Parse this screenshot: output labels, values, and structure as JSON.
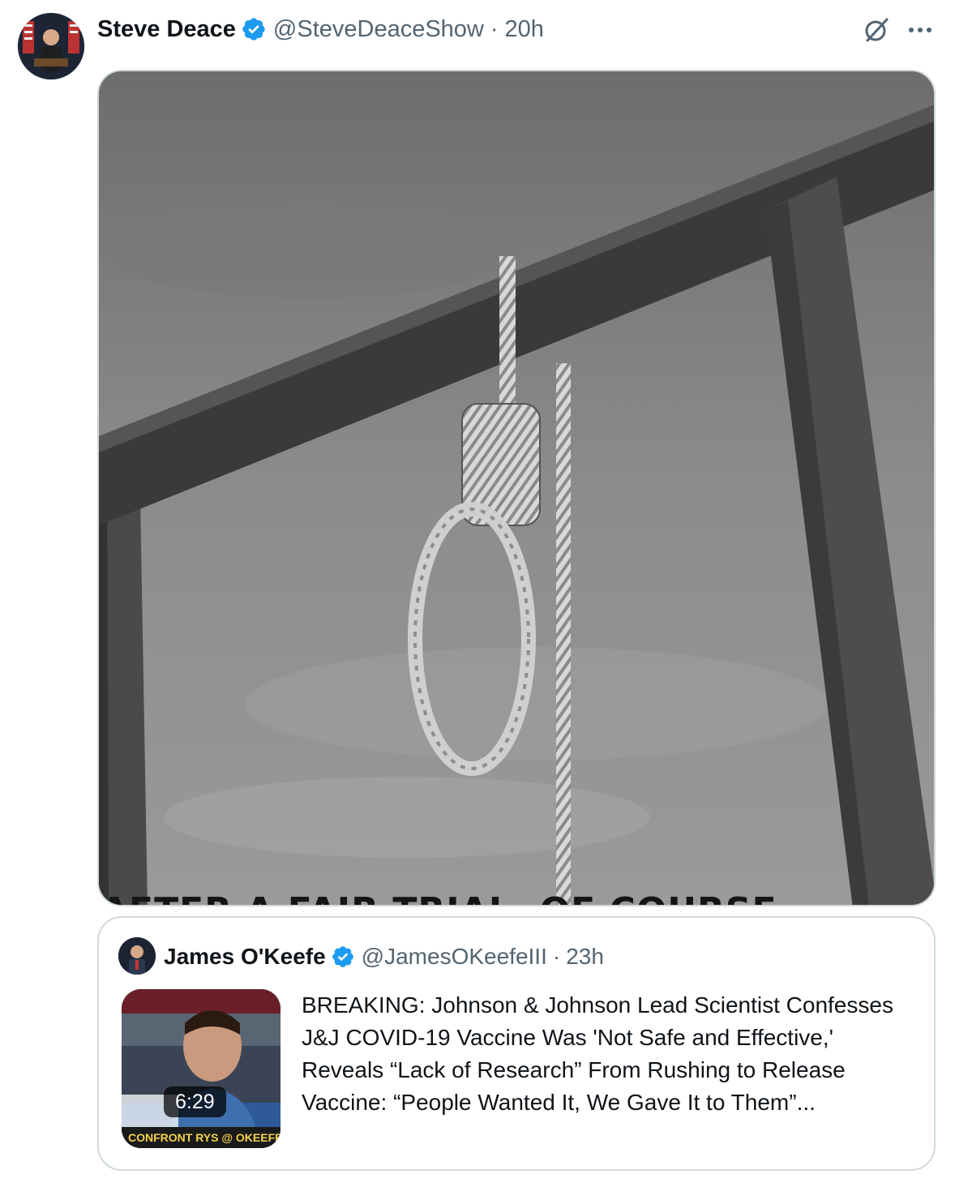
{
  "tweet": {
    "author_name": "Steve Deace",
    "handle": "@SteveDeaceShow",
    "separator": "·",
    "time": "20h",
    "verified_icon": "verified-badge-icon",
    "image_caption": "AFTER A FAIR TRIAL, OF COURSE"
  },
  "quoted": {
    "author_name": "James O'Keefe",
    "handle": "@JamesOKeefeIII",
    "separator": "·",
    "time": "23h",
    "video_duration": "6:29",
    "video_banner": "CONFRONT RYS @ OKEEFEMEDIA",
    "text": "BREAKING: Johnson & Johnson Lead Scientist Confesses J&J COVID-19 Vaccine Was 'Not Safe and Effective,' Reveals “Lack of Research” From Rushing to Release Vaccine: “People Wanted It, We Gave It to Them”..."
  },
  "colors": {
    "text_primary": "#0f1419",
    "text_secondary": "#536471",
    "verified_blue": "#1d9bf0",
    "border": "#cfd9de"
  }
}
